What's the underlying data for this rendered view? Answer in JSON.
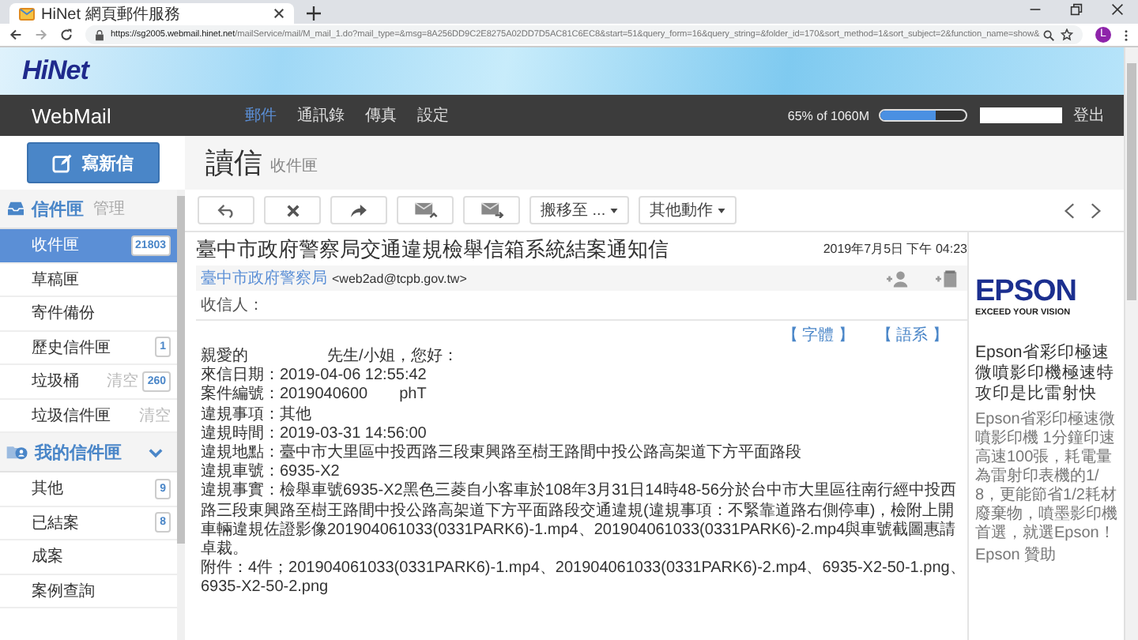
{
  "browser": {
    "tab_title": "HiNet 網頁郵件服務",
    "tab_selected": true,
    "url_host": "https://sg2005.webmail.hinet.net",
    "url_path": "/mailService/mail/M_mail_1.do?mail_type=&msg=8A256DD9C2E8275A02DD7D5AC81C6EC8&start=51&query_form=16&query_string=&folder_id=170&sort_method=1&sort_subject=2&function_name=show&",
    "profile_initial": "L"
  },
  "logo": "HiNet",
  "nav": {
    "brand": "WebMail",
    "tabs": [
      {
        "label": "郵件",
        "selected": true
      },
      {
        "label": "通訊錄",
        "selected": false
      },
      {
        "label": "傳真",
        "selected": false
      },
      {
        "label": "設定",
        "selected": false
      }
    ],
    "quota": {
      "text": "65% of 1060M",
      "level": 0.65
    },
    "logout": "登出"
  },
  "compose": "寫新信",
  "page_header": {
    "title": "讀信",
    "subtitle": "收件匣"
  },
  "sidebar": [
    {
      "title": "信件匣",
      "action": "管理",
      "kind": "inbox",
      "items": [
        {
          "label": "收件匣",
          "count": "21803",
          "selected": true
        },
        {
          "label": "草稿匣",
          "selected": false
        },
        {
          "label": "寄件備份",
          "selected": false
        },
        {
          "label": "歷史信件匣",
          "count": "1",
          "selected": false
        },
        {
          "label": "垃圾桶",
          "action": "清空",
          "count": "260",
          "selected": false
        },
        {
          "label": "垃圾信件匣",
          "action": "清空",
          "selected": false
        }
      ]
    },
    {
      "title": "我的信件匣",
      "kind": "personal",
      "expanded": true,
      "items": [
        {
          "label": "其他",
          "count": "9",
          "selected": false
        },
        {
          "label": "已結案",
          "count": "8",
          "selected": false
        },
        {
          "label": "成案",
          "selected": false
        },
        {
          "label": "案例查詢",
          "selected": false
        }
      ]
    }
  ],
  "toolbar": {
    "move": "搬移至 ...",
    "more": "其他動作"
  },
  "message": {
    "subject": "臺中市政府警察局交通違規檢舉信箱系統結案通知信",
    "date": "2019年7月5日 下午 04:23",
    "sender_name": "臺中市政府警察局",
    "sender_email": "<web2ad@tcpb.gov.tw>",
    "recipients_label": "收信人：",
    "links": [
      "【 字體 】",
      "【 語系 】"
    ],
    "body": [
      "親愛的　　　　　先生/小姐，您好：",
      "來信日期：2019-04-06 12:55:42",
      "案件編號：2019040600　　phT",
      "違規事項：其他",
      "違規時間：2019-03-31 14:56:00",
      "違規地點：臺中市大里區中投西路三段東興路至樹王路間中投公路高架道下方平面路段",
      "違規車號：6935-X2",
      "違規事實：檢舉車號6935-X2黑色三菱自小客車於108年3月31日14時48-56分於台中市大里區往南行經中投西路三段東興路至樹王路間中投公路高架道下方平面路段交通違規(違規事項：不緊靠道路右側停車)，檢附上開車輛違規佐證影像201904061033(0331PARK6)-1.mp4、201904061033(0331PARK6)-2.mp4與車號截圖惠請卓裁。",
      "附件：4件；201904061033(0331PARK6)-1.mp4、201904061033(0331PARK6)-2.mp4、6935-X2-50-1.png、6935-X2-50-2.png"
    ]
  },
  "ad": {
    "logo": "EPSON",
    "tagline": "EXCEED YOUR VISION",
    "title": "Epson省彩印極速微噴影印機極速特攻印是比雷射快",
    "text": "Epson省彩印極速微噴影印機 1分鐘印速高速100張，耗電量為雷射印表機的1/8，更能節省1/2耗材廢棄物，噴墨影印機首選，就選Epson！",
    "sponsor": "Epson 贊助"
  }
}
